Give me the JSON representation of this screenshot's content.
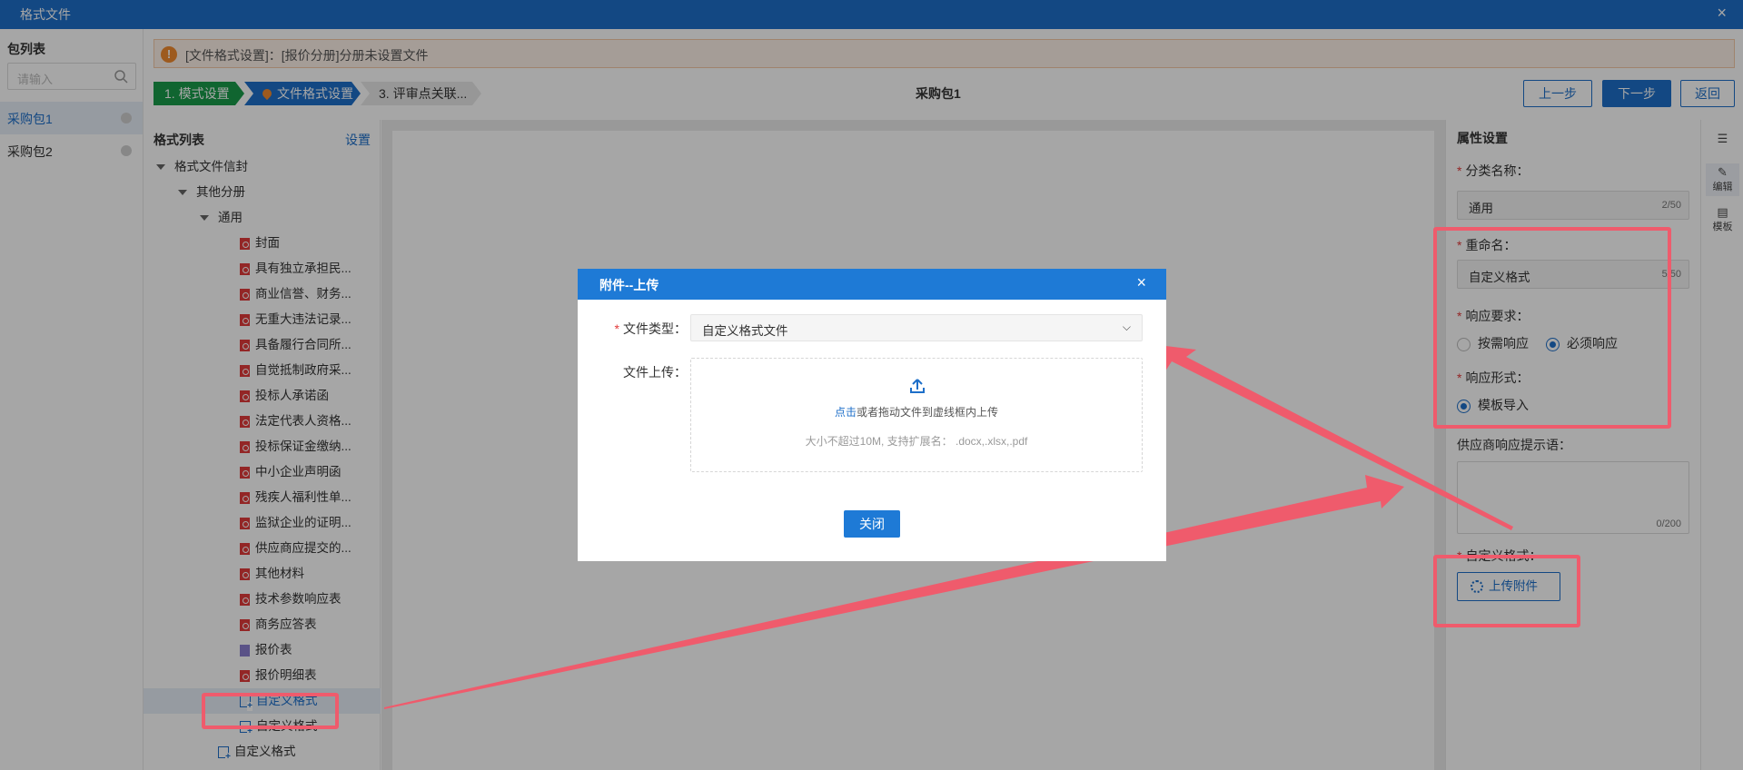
{
  "window": {
    "title": "格式文件",
    "close_glyph": "×"
  },
  "packages": {
    "header": "包列表",
    "search_placeholder": "请输入",
    "items": [
      {
        "label": "采购包1",
        "selected": true
      },
      {
        "label": "采购包2",
        "selected": false
      }
    ]
  },
  "alert": {
    "text": "[文件格式设置]：[报价分册]分册未设置文件"
  },
  "steps": [
    {
      "label": "1. 模式设置",
      "state": "done"
    },
    {
      "label": "文件格式设置",
      "state": "active"
    },
    {
      "label": "3. 评审点关联...",
      "state": "todo"
    }
  ],
  "page_title": "采购包1",
  "actions": {
    "prev": "上一步",
    "next": "下一步",
    "back": "返回"
  },
  "format_list": {
    "header": "格式列表",
    "settings": "设置",
    "root": "格式文件信封",
    "group": "其他分册",
    "subgroup": "通用",
    "files": [
      {
        "label": "封面",
        "icon": "pdf"
      },
      {
        "label": "具有独立承担民...",
        "icon": "pdf"
      },
      {
        "label": "商业信誉、财务...",
        "icon": "pdf"
      },
      {
        "label": "无重大违法记录...",
        "icon": "pdf"
      },
      {
        "label": "具备履行合同所...",
        "icon": "pdf"
      },
      {
        "label": "自觉抵制政府采...",
        "icon": "pdf"
      },
      {
        "label": "投标人承诺函",
        "icon": "pdf"
      },
      {
        "label": "法定代表人资格...",
        "icon": "pdf"
      },
      {
        "label": "投标保证金缴纳...",
        "icon": "pdf"
      },
      {
        "label": "中小企业声明函",
        "icon": "pdf"
      },
      {
        "label": "残疾人福利性单...",
        "icon": "pdf"
      },
      {
        "label": "监狱企业的证明...",
        "icon": "pdf"
      },
      {
        "label": "供应商应提交的...",
        "icon": "pdf"
      },
      {
        "label": "其他材料",
        "icon": "pdf"
      },
      {
        "label": "技术参数响应表",
        "icon": "pdf"
      },
      {
        "label": "商务应答表",
        "icon": "pdf"
      },
      {
        "label": "报价表",
        "icon": "doc"
      },
      {
        "label": "报价明细表",
        "icon": "pdf"
      },
      {
        "label": "自定义格式",
        "icon": "custom",
        "selected": true
      },
      {
        "label": "自定义格式",
        "icon": "custom"
      }
    ],
    "outer_item": "自定义格式"
  },
  "properties": {
    "header": "属性设置",
    "category_label": "分类名称：",
    "category_value": "通用",
    "category_count": "2/50",
    "rename_label": "重命名：",
    "rename_value": "自定义格式",
    "rename_count": "5/50",
    "response_req_label": "响应要求：",
    "response_req_options": [
      {
        "label": "按需响应",
        "checked": false
      },
      {
        "label": "必须响应",
        "checked": true
      }
    ],
    "response_form_label": "响应形式：",
    "response_form_option": "模板导入",
    "hint_label": "供应商响应提示语：",
    "hint_count": "0/200",
    "custom_format_label": "自定义格式：",
    "upload_button": "上传附件"
  },
  "rail": [
    {
      "icon": "indent-icon",
      "label": "",
      "glyph": "☰"
    },
    {
      "icon": "edit-icon",
      "label": "编辑",
      "glyph": "✎"
    },
    {
      "icon": "template-icon",
      "label": "模板",
      "glyph": "▤"
    }
  ],
  "modal": {
    "title": "附件--上传",
    "close_glyph": "×",
    "type_label": "文件类型：",
    "type_value": "自定义格式文件",
    "upload_label": "文件上传：",
    "drop_link": "点击",
    "drop_text": "或者拖动文件到虚线框内上传",
    "drop_hint": "大小不超过10M, 支持扩展名：  .docx,.xlsx,.pdf",
    "close_button": "关闭"
  },
  "colors": {
    "primary": "#1e6fc9",
    "success": "#1a9c4b",
    "warning": "#f28b2e",
    "annotation": "#ef5b6c"
  }
}
